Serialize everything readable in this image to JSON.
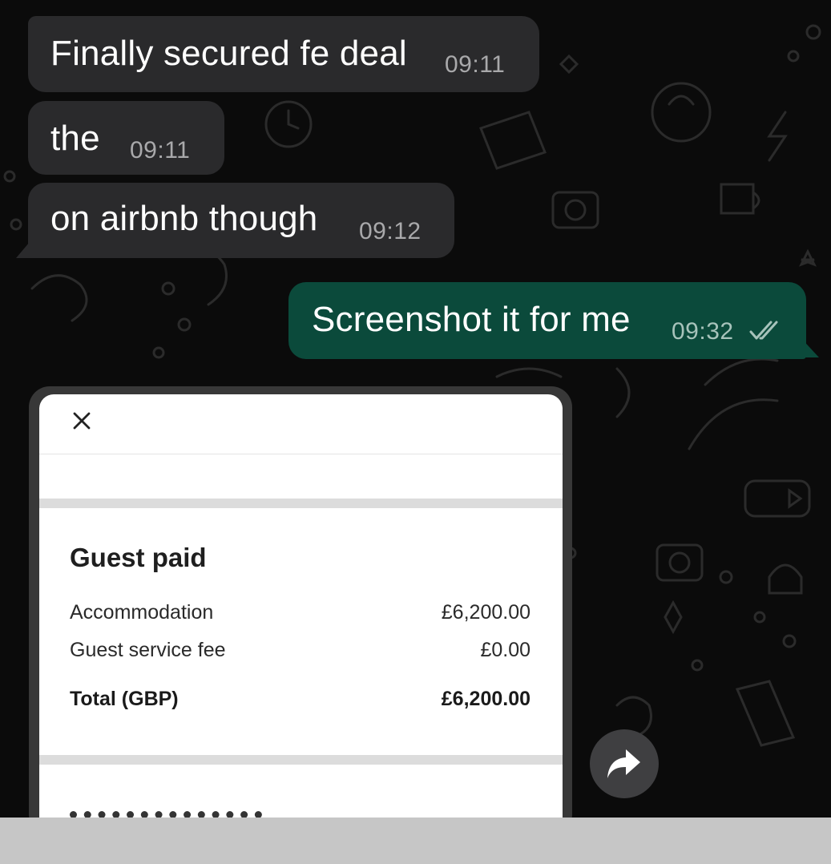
{
  "messages": [
    {
      "direction": "incoming",
      "text": "Finally secured fe deal",
      "time": "09:11"
    },
    {
      "direction": "incoming",
      "text": "the",
      "time": "09:11"
    },
    {
      "direction": "incoming",
      "text": "on airbnb though",
      "time": "09:12"
    },
    {
      "direction": "outgoing",
      "text": "Screenshot it for me",
      "time": "09:32",
      "status_icon": "double-check-icon"
    }
  ],
  "receipt": {
    "close_icon": "close-icon",
    "heading": "Guest paid",
    "rows": [
      {
        "label": "Accommodation",
        "value": "£6,200.00"
      },
      {
        "label": "Guest service fee",
        "value": "£0.00"
      },
      {
        "label": "Total (GBP)",
        "value": "£6,200.00"
      }
    ]
  },
  "forward_icon": "forward-arrow-icon",
  "colors": {
    "background": "#0b0b0b",
    "incoming_bubble": "#2a2a2c",
    "outgoing_bubble": "#0b4a3b",
    "receipt_card": "#ffffff",
    "bottom_bar": "#c6c6c6"
  }
}
